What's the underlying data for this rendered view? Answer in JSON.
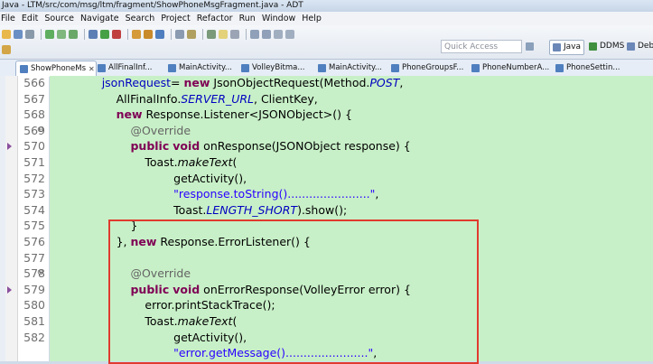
{
  "window": {
    "title": "Java - LTM/src/com/msg/ltm/fragment/ShowPhoneMsgFragment.java - ADT"
  },
  "menu": [
    "File",
    "Edit",
    "Source",
    "Navigate",
    "Search",
    "Project",
    "Refactor",
    "Run",
    "Window",
    "Help"
  ],
  "toolbar": {
    "quick_access_placeholder": "Quick Access",
    "perspectives": [
      "Java",
      "DDMS",
      "Debi"
    ]
  },
  "tabs": [
    {
      "label": "ShowPhoneMs"
    },
    {
      "label": "AllFinalInf..."
    },
    {
      "label": "MainActivity..."
    },
    {
      "label": "VolleyBitma..."
    },
    {
      "label": "MainActivity..."
    },
    {
      "label": "PhoneGroupsF..."
    },
    {
      "label": "PhoneNumberA..."
    },
    {
      "label": "PhoneSettin..."
    }
  ],
  "code": {
    "line_numbers": [
      "566",
      "567",
      "568",
      "569",
      "570",
      "571",
      "572",
      "573",
      "574",
      "575",
      "576",
      "577",
      "578",
      "579",
      "580",
      "581",
      "582"
    ],
    "lines": [
      {
        "ind": "            ",
        "parts": [
          [
            "var",
            "jsonRequest"
          ],
          [
            "",
            "= "
          ],
          [
            "kw",
            "new"
          ],
          [
            "",
            " JsonObjectRequest(Method."
          ],
          [
            "fld",
            "POST"
          ],
          [
            "",
            ","
          ]
        ]
      },
      {
        "ind": "                ",
        "parts": [
          [
            "",
            "AllFinalInfo."
          ],
          [
            "fld",
            "SERVER_URL"
          ],
          [
            "",
            ", ClientKey,"
          ]
        ]
      },
      {
        "ind": "                ",
        "parts": [
          [
            "kw",
            "new"
          ],
          [
            "",
            " Response.Listener<JSONObject>() {"
          ]
        ]
      },
      {
        "ind": "                    ",
        "parts": [
          [
            "ann",
            "@Override"
          ]
        ]
      },
      {
        "ind": "                    ",
        "parts": [
          [
            "kw",
            "public"
          ],
          [
            "",
            " "
          ],
          [
            "kw",
            "void"
          ],
          [
            "",
            " onResponse(JSONObject response) {"
          ]
        ]
      },
      {
        "ind": "                        ",
        "parts": [
          [
            "",
            "Toast."
          ],
          [
            "it",
            "makeText"
          ],
          [
            "",
            "("
          ]
        ]
      },
      {
        "ind": "                                ",
        "parts": [
          [
            "",
            "getActivity(),"
          ]
        ]
      },
      {
        "ind": "                                ",
        "parts": [
          [
            "str",
            "\"response.toString().......................\""
          ],
          [
            "",
            ","
          ]
        ]
      },
      {
        "ind": "                                ",
        "parts": [
          [
            "",
            "Toast."
          ],
          [
            "fld",
            "LENGTH_SHORT"
          ],
          [
            "",
            ").show();"
          ]
        ]
      },
      {
        "ind": "                    ",
        "parts": [
          [
            "",
            "}"
          ]
        ]
      },
      {
        "ind": "                ",
        "parts": [
          [
            "",
            "}, "
          ],
          [
            "kw",
            "new"
          ],
          [
            "",
            " Response.ErrorListener() {"
          ]
        ]
      },
      {
        "ind": "",
        "parts": []
      },
      {
        "ind": "                    ",
        "parts": [
          [
            "ann",
            "@Override"
          ]
        ]
      },
      {
        "ind": "                    ",
        "parts": [
          [
            "kw",
            "public"
          ],
          [
            "",
            " "
          ],
          [
            "kw",
            "void"
          ],
          [
            "",
            " onErrorResponse(VolleyError error) {"
          ]
        ]
      },
      {
        "ind": "                        ",
        "parts": [
          [
            "",
            "error.printStackTrace();"
          ]
        ]
      },
      {
        "ind": "                        ",
        "parts": [
          [
            "",
            "Toast."
          ],
          [
            "it",
            "makeText"
          ],
          [
            "",
            "("
          ]
        ]
      },
      {
        "ind": "                                ",
        "parts": [
          [
            "",
            "getActivity(),"
          ]
        ]
      },
      {
        "ind": "                                ",
        "parts": [
          [
            "str",
            "\"error.getMessage().......................\""
          ],
          [
            "",
            ","
          ]
        ]
      }
    ]
  },
  "colors": {
    "editor_bg": "#c8f0c8",
    "highlight_box": "#e03a2e",
    "keyword": "#7f0055",
    "string": "#2a00ff",
    "field": "#0000c0"
  }
}
